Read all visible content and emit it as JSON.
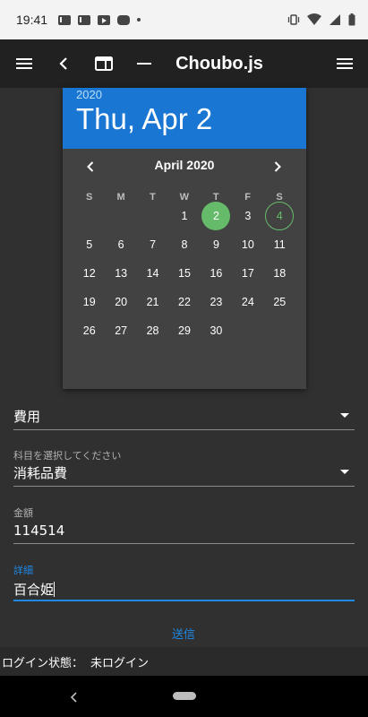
{
  "status_bar": {
    "time": "19:41",
    "notification_icons": [
      "gmail-icon",
      "gmail-icon",
      "youtube-icon",
      "game-icon",
      "dot-icon"
    ],
    "system_icons": [
      "vibrate-icon",
      "wifi-icon",
      "signal-icon",
      "battery-icon"
    ]
  },
  "app_bar": {
    "title": "Choubo.js",
    "icons": [
      "menu-icon",
      "back-icon",
      "window-icon",
      "minimize-icon",
      "menu-icon"
    ]
  },
  "date_picker": {
    "year": "2020",
    "selected_date": "Thu, Apr 2",
    "month_label": "April 2020",
    "weekdays": [
      "S",
      "M",
      "T",
      "W",
      "T",
      "F",
      "S"
    ],
    "first_weekday_index": 3,
    "days": [
      "1",
      "2",
      "3",
      "4",
      "5",
      "6",
      "7",
      "8",
      "9",
      "10",
      "11",
      "12",
      "13",
      "14",
      "15",
      "16",
      "17",
      "18",
      "19",
      "20",
      "21",
      "22",
      "23",
      "24",
      "25",
      "26",
      "27",
      "28",
      "29",
      "30"
    ],
    "selected_day": "2",
    "today_day": "4",
    "accent_color": "#66bb6a",
    "header_color": "#1976d2"
  },
  "form": {
    "type_select": {
      "value": "費用"
    },
    "account_select": {
      "label": "科目を選択してください",
      "value": "消耗品費"
    },
    "amount_field": {
      "label": "金額",
      "value": "114514"
    },
    "detail_field": {
      "label": "詳細",
      "value": "百合姫"
    },
    "submit_label": "送信",
    "focus_color": "#1e88e5"
  },
  "login_status": {
    "label": "ログイン状態：",
    "value": "未ログイン"
  }
}
